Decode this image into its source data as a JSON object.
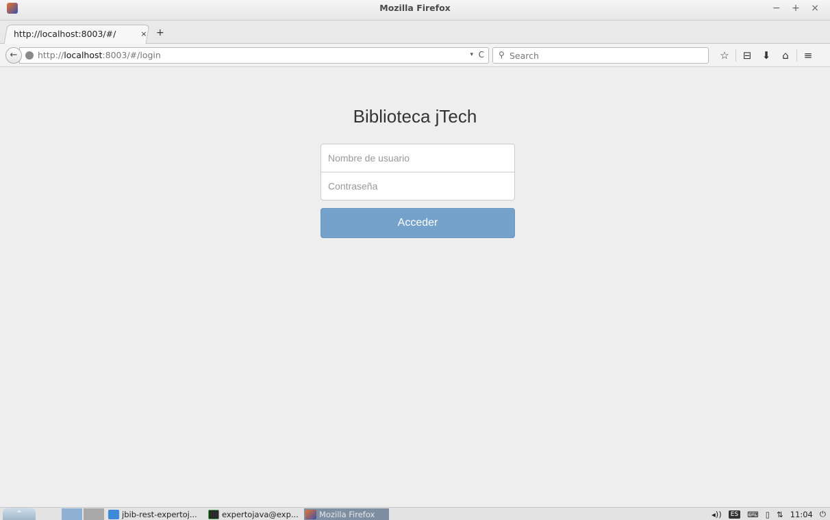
{
  "window": {
    "title": "Mozilla Firefox",
    "controls": "− + ×"
  },
  "tabs": [
    {
      "label": "http://localhost:8003/#/",
      "close": "×"
    }
  ],
  "new_tab": "+",
  "nav": {
    "back": "←",
    "url_host": "localhost",
    "url_prefix": "http://",
    "url_suffix": ":8003/#/login",
    "url_dropdown": "▾",
    "reload": "C",
    "search_placeholder": "Search",
    "icons": [
      "star-icon",
      "reading-list-icon",
      "download-icon",
      "home-icon",
      "menu-icon"
    ],
    "icon_glyphs": [
      "☆",
      "⊟",
      "⬇",
      "⌂",
      "≡"
    ]
  },
  "login": {
    "title": "Biblioteca jTech",
    "username_placeholder": "Nombre de usuario",
    "password_placeholder": "Contraseña",
    "submit_label": "Acceder"
  },
  "taskbar": {
    "tasks": [
      {
        "label": "jbib-rest-expertoj..."
      },
      {
        "label": "expertojava@exp..."
      },
      {
        "label": "Mozilla Firefox"
      }
    ],
    "tray": {
      "volume": "◂))",
      "lang": "ES",
      "keyboard": "⌨",
      "battery": "▯",
      "network": "⇅",
      "time": "11:04",
      "power": "⏻"
    }
  },
  "colors": {
    "accent_button": "#74a2cb",
    "page_bg": "#eeeeee"
  }
}
